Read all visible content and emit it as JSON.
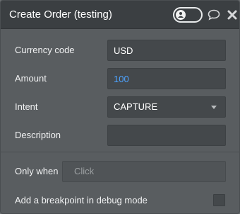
{
  "header": {
    "title": "Create Order (testing)",
    "toggle_icon": "debug-toggle-icon",
    "comment_icon": "comment-icon",
    "close_icon": "close-icon"
  },
  "fields": {
    "currency": {
      "label": "Currency code",
      "value": "USD"
    },
    "amount": {
      "label": "Amount",
      "value": "100"
    },
    "intent": {
      "label": "Intent",
      "value": "CAPTURE"
    },
    "description": {
      "label": "Description",
      "value": ""
    }
  },
  "only_when": {
    "label": "Only when",
    "placeholder": "Click"
  },
  "breakpoint": {
    "label": "Add a breakpoint in debug mode",
    "checked": false
  },
  "colors": {
    "header_bg": "#3b3f42",
    "panel_bg": "#595d60",
    "field_bg": "#44484b",
    "value_blue": "#4da3ff"
  }
}
